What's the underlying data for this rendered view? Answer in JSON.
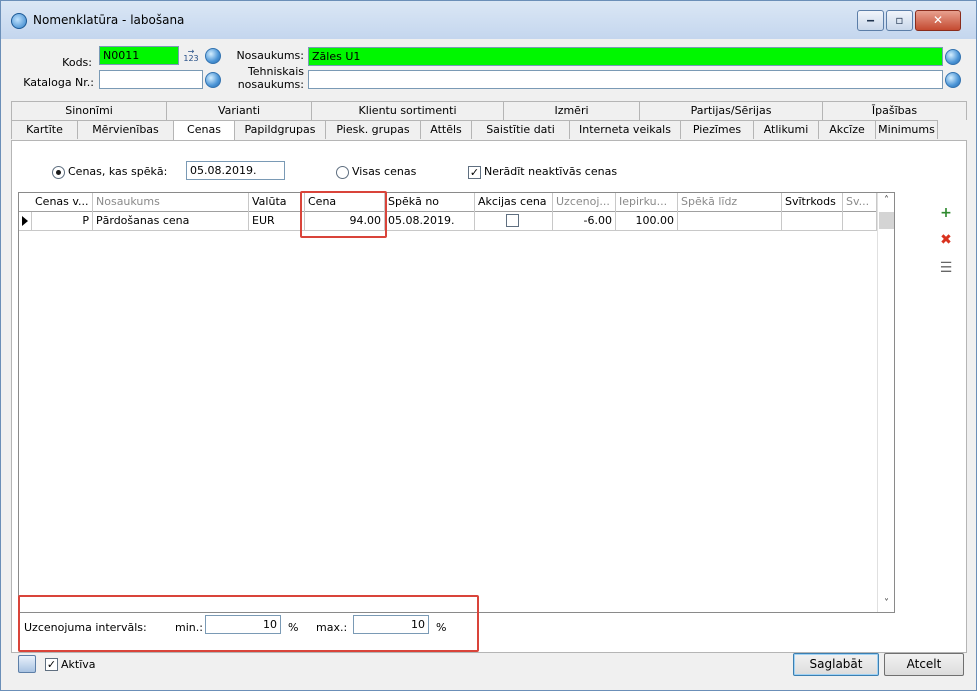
{
  "window": {
    "title": "Nomenklatūra - labošana"
  },
  "header": {
    "kods_label": "Kods:",
    "kods_value": "N0011",
    "kataloga_label": "Kataloga Nr.:",
    "kataloga_value": "",
    "nosaukums_label": "Nosaukums:",
    "nosaukums_value": "Zāles U1",
    "tehniskais_label_1": "Tehniskais",
    "tehniskais_label_2": "nosaukums:",
    "tehniskais_value": ""
  },
  "tabs_top": [
    {
      "label": "Sinonīmi"
    },
    {
      "label": "Varianti"
    },
    {
      "label": "Klientu sortimenti"
    },
    {
      "label": "Izmēri"
    },
    {
      "label": "Partijas/Sērijas"
    },
    {
      "label": "Īpašības"
    }
  ],
  "tabs_bottom": [
    {
      "label": "Kartīte"
    },
    {
      "label": "Mērvienības"
    },
    {
      "label": "Cenas"
    },
    {
      "label": "Papildgrupas"
    },
    {
      "label": "Piesk. grupas"
    },
    {
      "label": "Attēls"
    },
    {
      "label": "Saistītie dati"
    },
    {
      "label": "Interneta veikals"
    },
    {
      "label": "Piezīmes"
    },
    {
      "label": "Atlikumi"
    },
    {
      "label": "Akcīze"
    },
    {
      "label": "Minimums"
    }
  ],
  "filters": {
    "radio_valid_label": "Cenas, kas spēkā:",
    "date_value": "05.08.2019.",
    "radio_all_label": "Visas cenas",
    "hide_inactive_label": "Nerādīt neaktīvās cenas",
    "hide_inactive_checked": "✓"
  },
  "grid": {
    "columns": [
      {
        "label": "Cenas v..."
      },
      {
        "label": "Nosaukums"
      },
      {
        "label": "Valūta"
      },
      {
        "label": "Cena"
      },
      {
        "label": "Spēkā no"
      },
      {
        "label": "Akcijas cena"
      },
      {
        "label": "Uzcenoj..."
      },
      {
        "label": "Iepirku..."
      },
      {
        "label": "Spēkā līdz"
      },
      {
        "label": "Svītrkods"
      },
      {
        "label": "Sv..."
      }
    ],
    "rows": [
      {
        "type": "P",
        "name": "Pārdošanas cena",
        "currency": "EUR",
        "price": "94.00",
        "valid_from": "05.08.2019.",
        "markup": "-6.00",
        "purchase": "100.00"
      }
    ]
  },
  "markup_interval": {
    "label": "Uzcenojuma intervāls:",
    "min_label": "min.:",
    "min_value": "10",
    "min_unit": "%",
    "max_label": "max.:",
    "max_value": "10",
    "max_unit": "%"
  },
  "footer": {
    "active_label": "Aktīva",
    "active_checked": "✓",
    "save_label": "Saglabāt",
    "cancel_label": "Atcelt"
  },
  "icons": {
    "window_minimize": "‒",
    "window_maximize": "▫",
    "window_close": "✕",
    "add": "+",
    "delete": "✖",
    "columns": "☰",
    "scroll_up": "˄",
    "scroll_down": "˅",
    "sequence": "→ 123"
  },
  "colors": {
    "highlight_field": "#00f700",
    "annotation_box": "#d9443a"
  }
}
